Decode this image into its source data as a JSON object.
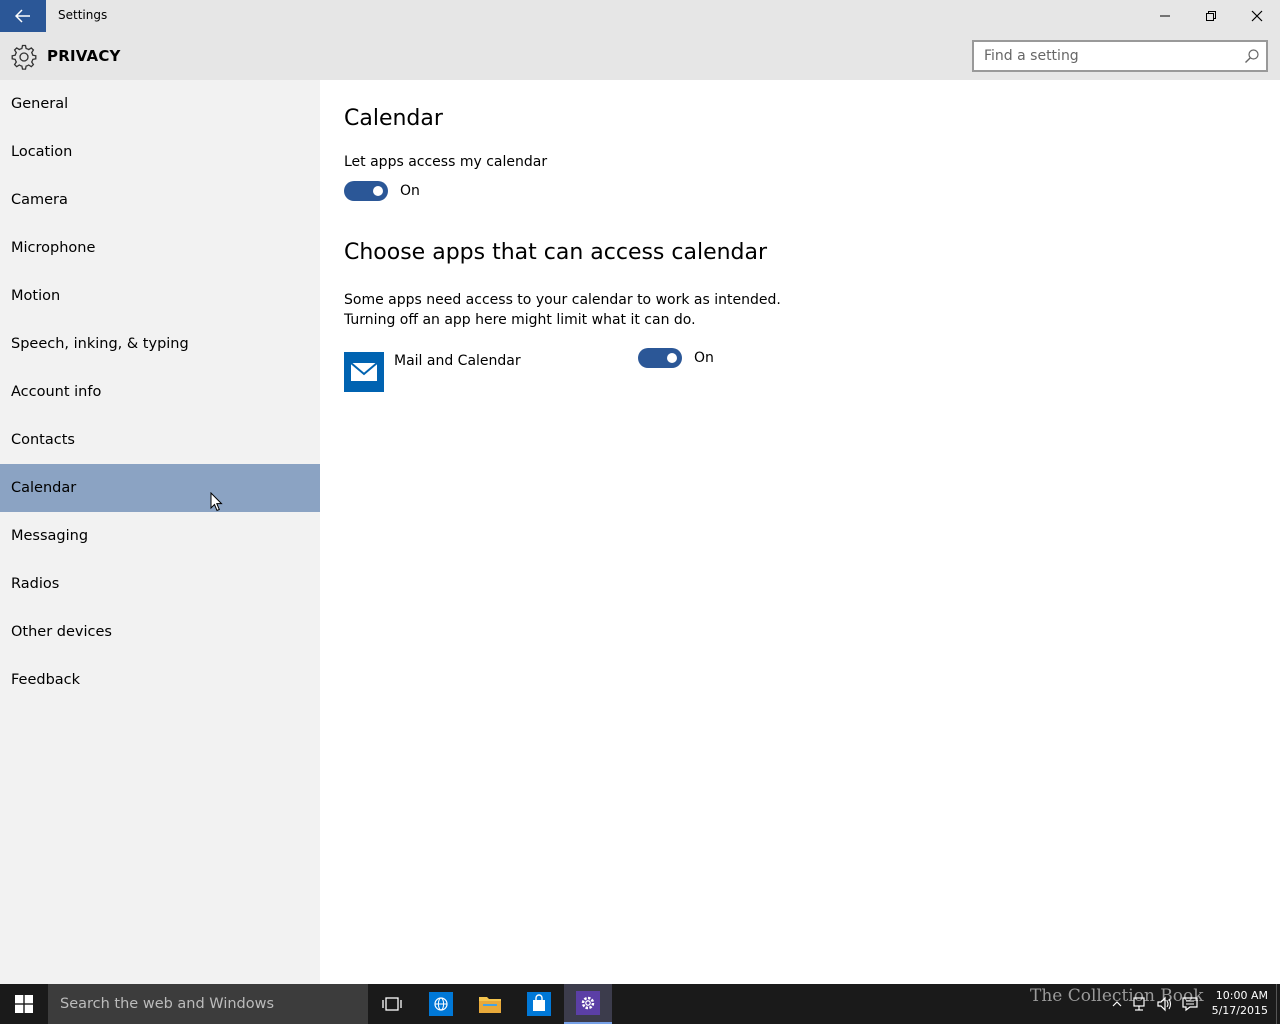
{
  "window": {
    "title": "Settings"
  },
  "header": {
    "section_title": "PRIVACY",
    "search_placeholder": "Find a setting"
  },
  "sidebar": {
    "items": [
      {
        "label": "General",
        "active": false
      },
      {
        "label": "Location",
        "active": false
      },
      {
        "label": "Camera",
        "active": false
      },
      {
        "label": "Microphone",
        "active": false
      },
      {
        "label": "Motion",
        "active": false
      },
      {
        "label": "Speech, inking, & typing",
        "active": false
      },
      {
        "label": "Account info",
        "active": false
      },
      {
        "label": "Contacts",
        "active": false
      },
      {
        "label": "Calendar",
        "active": true
      },
      {
        "label": "Messaging",
        "active": false
      },
      {
        "label": "Radios",
        "active": false
      },
      {
        "label": "Other devices",
        "active": false
      },
      {
        "label": "Feedback",
        "active": false
      }
    ]
  },
  "main": {
    "title": "Calendar",
    "master_toggle_label": "Let apps access my calendar",
    "master_toggle_state": "On",
    "apps_heading": "Choose apps that can access calendar",
    "apps_description_line1": "Some apps need access to your calendar to work as intended.",
    "apps_description_line2": "Turning off an app here might limit what it can do.",
    "apps": [
      {
        "name": "Mail and Calendar",
        "state": "On",
        "icon": "mail-icon"
      }
    ]
  },
  "taskbar": {
    "search_placeholder": "Search the web and Windows",
    "watermark": "The Collection Book",
    "time": "10:00 AM",
    "date": "5/17/2015"
  },
  "colors": {
    "accent": "#2b5797",
    "active_nav": "#8ba3c3",
    "app_tile": "#0063b1"
  }
}
